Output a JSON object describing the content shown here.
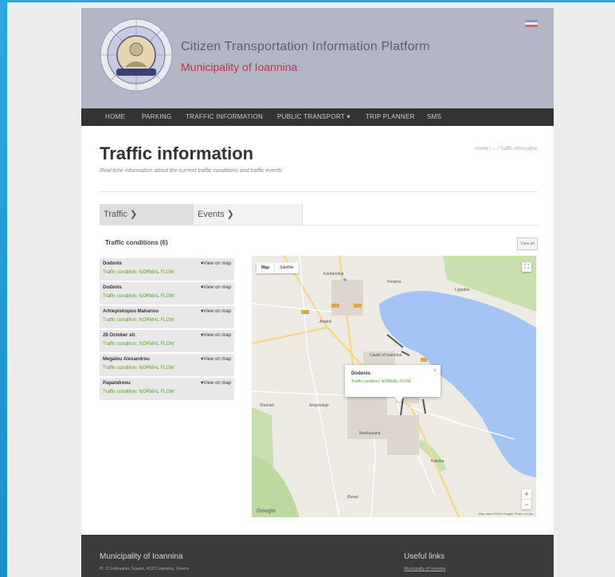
{
  "header": {
    "title": "Citizen Transportation Information Platform",
    "subtitle": "Municipality of Ioannina",
    "logo_icon": "municipality-seal"
  },
  "nav": {
    "items": [
      "HOME",
      "PARKING",
      "TRAFFIC INFORMATION",
      "PUBLIC TRANSPORT ▾",
      "TRIP PLANNER",
      "SMS"
    ]
  },
  "page": {
    "title": "Traffic information",
    "description": "Real-time information about the current traffic conditions and traffic events",
    "breadcrumb": "Home / ... / Traffic information"
  },
  "tabs": {
    "traffic": "Traffic ❯",
    "events": "Events ❯"
  },
  "traffic": {
    "section_title": "Traffic conditions (6)",
    "view_label": "View all",
    "items": [
      {
        "name": "Dodonis",
        "status": "Traffic condition: NORMAL FLOW",
        "map_link": "View on map"
      },
      {
        "name": "Dodonis",
        "status": "Traffic condition: NORMAL FLOW",
        "map_link": "View on map"
      },
      {
        "name": "Arhiepiskopou Makariou",
        "status": "Traffic condition: NORMAL FLOW",
        "map_link": "View on map"
      },
      {
        "name": "28 October str.",
        "status": "Traffic condition: NORMAL FLOW",
        "map_link": "View on map"
      },
      {
        "name": "Megalou Alexandrou",
        "status": "Traffic condition: NORMAL FLOW",
        "map_link": "View on map"
      },
      {
        "name": "Papandreou",
        "status": "Traffic condition: NORMAL FLOW",
        "map_link": "View on map"
      }
    ]
  },
  "map": {
    "type_map": "Map",
    "type_satellite": "Satellite",
    "popup_title": "Dodonis",
    "popup_status": "Traffic condition: NORMAL FLOW",
    "google": "Google",
    "attribution": "Map data ©2015 Google  Terms of Use",
    "colors": {
      "lake": "#a3c4f5",
      "park": "#c8e0b0",
      "land": "#eeebe4"
    }
  },
  "footer": {
    "title": "Municipality of Ioannina",
    "address": "Pl. 21 Februariou Square, 45221 Ioannina, Greece",
    "links_title": "Useful links",
    "link1": "Municipality of Ioannina"
  }
}
